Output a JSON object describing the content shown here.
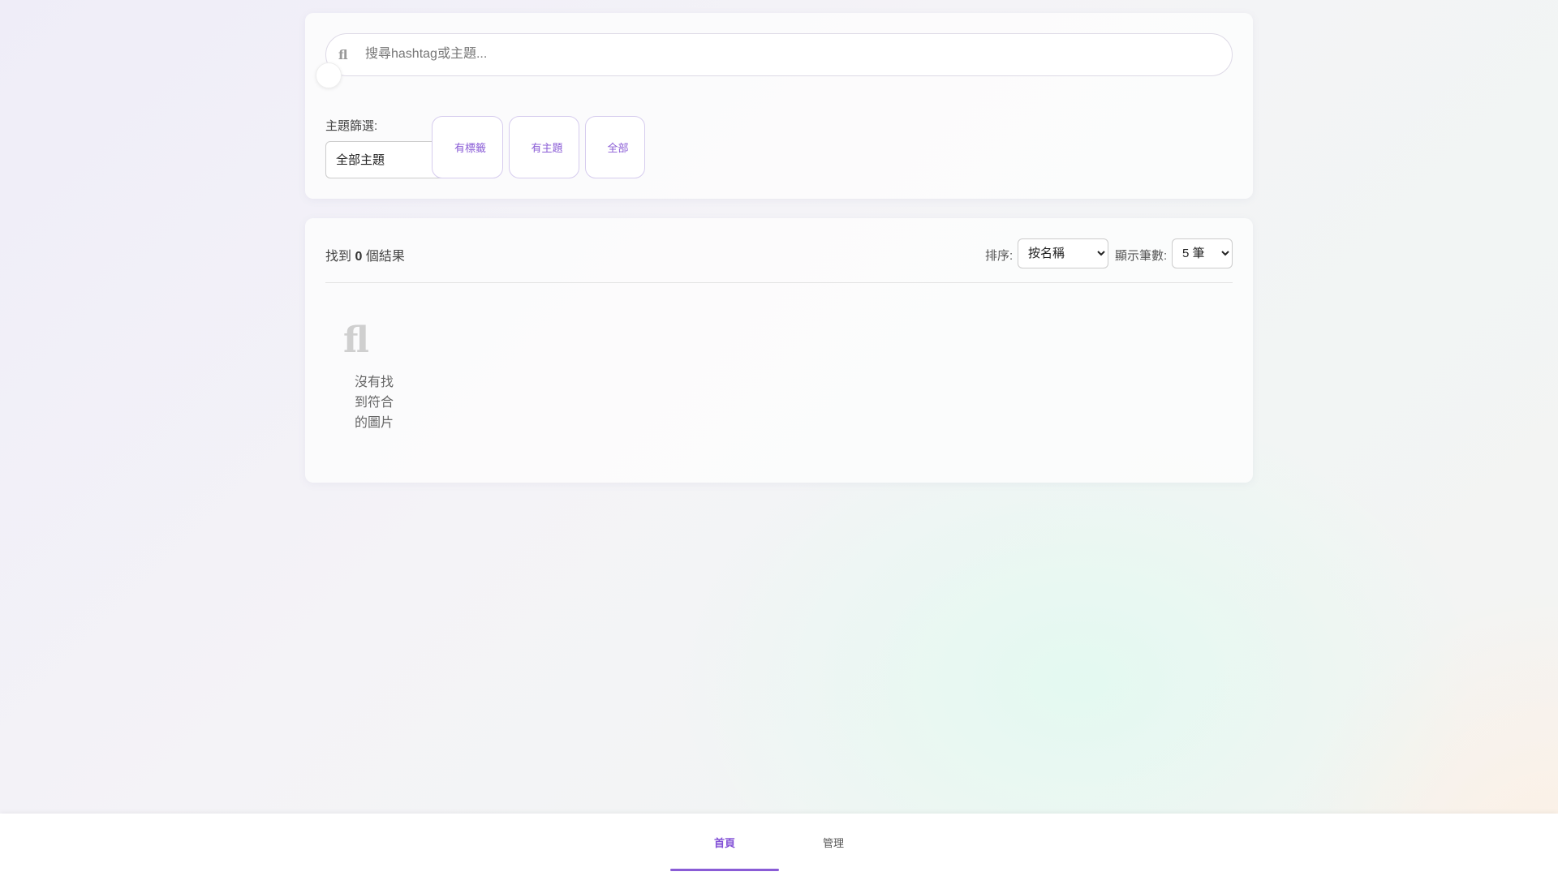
{
  "search": {
    "placeholder": "搜尋hashtag或主題...",
    "glyph": "ﬂ",
    "icon_glyph": "",
    "icon_name": "search-icon"
  },
  "filters": {
    "topic_label": "主題篩選:",
    "topic_select_value": "全部主題",
    "chips": [
      {
        "label": "有標籤",
        "icon_glyph": "",
        "icon_name": "tag-icon"
      },
      {
        "label": "有主題",
        "icon_glyph": "",
        "icon_name": "folder-icon"
      },
      {
        "label": "全部",
        "icon_glyph": "",
        "icon_name": "grid-icon"
      }
    ]
  },
  "results": {
    "count_prefix": "找到",
    "count": "0",
    "count_suffix": "個結果",
    "sort_label": "排序:",
    "sort_value": "按名稱",
    "perpage_label": "顯示筆數:",
    "perpage_value": "5 筆",
    "empty_glyph": "ﬂ",
    "empty_text": "沒有找到符合的圖片"
  },
  "nav": {
    "items": [
      {
        "label": "首頁",
        "icon_glyph": "",
        "icon_name": "home-icon",
        "active": true
      },
      {
        "label": "管理",
        "icon_glyph": "",
        "icon_name": "settings-icon",
        "active": false
      }
    ]
  },
  "colors": {
    "accent": "#8a5cd6",
    "chip_border": "#d6ccee"
  }
}
